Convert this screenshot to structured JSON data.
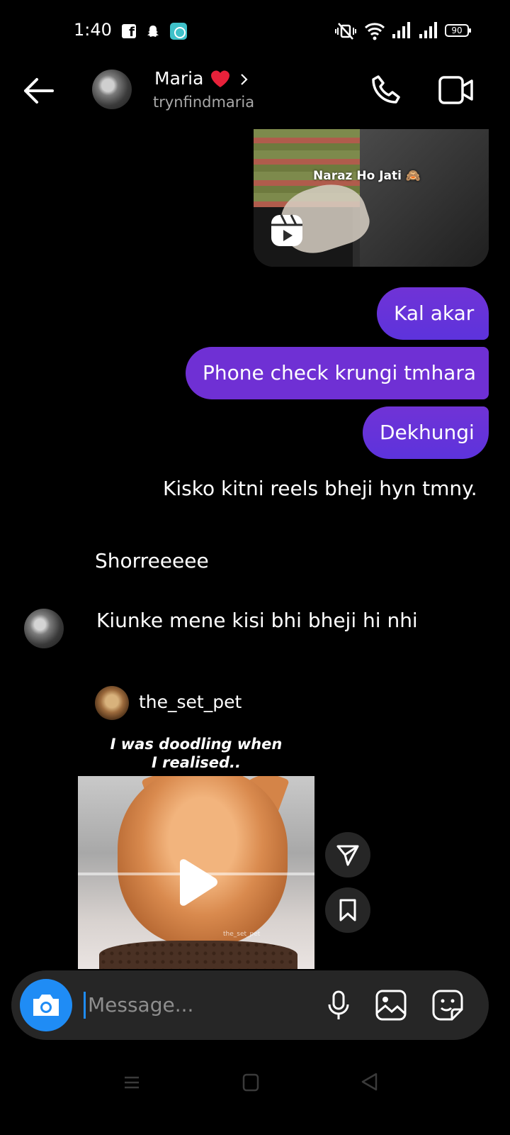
{
  "status_bar": {
    "time": "1:40",
    "battery": "90",
    "icons": [
      "facebook-icon",
      "snapchat-icon",
      "app-icon",
      "mute-vibrate-icon",
      "wifi-icon",
      "signal-icon",
      "signal-icon",
      "battery-icon"
    ]
  },
  "header": {
    "name": "Maria",
    "name_emoji": "red-heart",
    "handle": "trynfindmaria"
  },
  "reel": {
    "caption": "Naraz Ho Jati 🙈"
  },
  "messages": {
    "sent_1": "Kal akar",
    "sent_2": "Phone check krungi tmhara",
    "sent_3": "Dekhungi",
    "sent_4": "Kisko kitni reels bheji hyn tmny.",
    "received_1": "Shorreeeee",
    "received_2": "Kiunke mene kisi bhi bheji hi nhi"
  },
  "shared_post": {
    "username": "the_set_pet",
    "caption_line1": "I was doodling when",
    "caption_line2": "I realised..",
    "watermark": "the_set_pet"
  },
  "composer": {
    "placeholder": "Message..."
  },
  "colors": {
    "sent_bubble": "#6b2ed6",
    "camera_button": "#1f8cf5",
    "composer_bg": "#262626",
    "background": "#000000"
  }
}
